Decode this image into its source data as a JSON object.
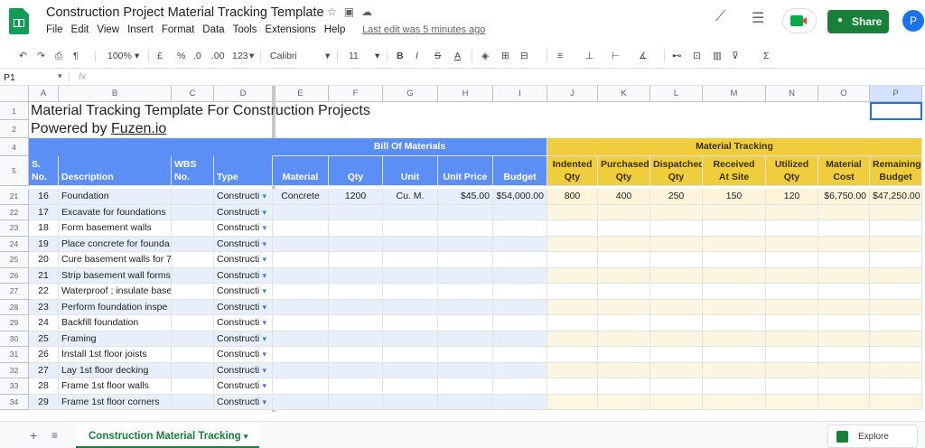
{
  "header": {
    "title": "Construction Project Material Tracking Template",
    "menus": [
      "File",
      "Edit",
      "View",
      "Insert",
      "Format",
      "Data",
      "Tools",
      "Extensions",
      "Help"
    ],
    "last_edit": "Last edit was 5 minutes ago",
    "share_label": "Share",
    "avatar_initial": "P"
  },
  "toolbar": {
    "zoom": "100%",
    "currency": "£",
    "percent": "%",
    "dec_dec": ".0",
    "dec_inc": ".00",
    "more_formats": "123",
    "font": "Calibri",
    "font_size": "11"
  },
  "formula_bar": {
    "cell_ref": "P1",
    "fx": "fx",
    "value": ""
  },
  "columns": [
    "A",
    "B",
    "C",
    "D",
    "E",
    "F",
    "G",
    "H",
    "I",
    "J",
    "K",
    "L",
    "M",
    "N",
    "O",
    "P"
  ],
  "sheet": {
    "title": "Material Tracking Template For Construction Projects",
    "powered_prefix": "Powered by ",
    "powered_link": "Fuzen.io",
    "bom_header": "Bill Of Materials",
    "mt_header": "Material Tracking",
    "headers": {
      "sno": "S. No.",
      "desc": "Description",
      "wbs1": "WBS",
      "wbs2": "No.",
      "type": "Type",
      "material": "Material",
      "qty": "Qty",
      "unit": "Unit",
      "unit_price": "Unit Price",
      "budget": "Budget",
      "indented1": "Indented",
      "indented2": "Qty",
      "purchased1": "Purchased",
      "purchased2": "Qty",
      "dispatched1": "Dispatched",
      "dispatched2": "Qty",
      "received1": "Qty Received",
      "received2": "At Site",
      "utilized1": "Utilized",
      "utilized2": "Qty",
      "matcost1": "Material",
      "matcost2": "Cost",
      "remain1": "Remaining",
      "remain2": "Budget"
    },
    "header_row_numbers": [
      "1",
      "2",
      "4",
      "5"
    ],
    "rows": [
      {
        "row": "21",
        "sno": "16",
        "desc": "Foundation",
        "type": "Constructi",
        "material": "Concrete",
        "qty": "1200",
        "unit": "Cu. M.",
        "unit_price": "$45.00",
        "budget": "$54,000.00",
        "indented": "800",
        "purchased": "400",
        "dispatched": "250",
        "received": "150",
        "utilized": "120",
        "matcost": "$6,750.00",
        "remain": "$47,250.00"
      },
      {
        "row": "22",
        "sno": "17",
        "desc": "Excavate for foundations",
        "type": "Constructi"
      },
      {
        "row": "23",
        "sno": "18",
        "desc": "Form basement walls",
        "type": "Constructi"
      },
      {
        "row": "24",
        "sno": "19",
        "desc": "Place concrete for founda",
        "type": "Constructi"
      },
      {
        "row": "25",
        "sno": "20",
        "desc": "Cure basement walls for 7",
        "type": "Constructi"
      },
      {
        "row": "26",
        "sno": "21",
        "desc": "Strip basement wall forms",
        "type": "Constructi"
      },
      {
        "row": "27",
        "sno": "22",
        "desc": "Waterproof ; insulate base",
        "type": "Constructi"
      },
      {
        "row": "28",
        "sno": "23",
        "desc": "Perform foundation inspe",
        "type": "Constructi"
      },
      {
        "row": "29",
        "sno": "24",
        "desc": "Backfill foundation",
        "type": "Constructi"
      },
      {
        "row": "30",
        "sno": "25",
        "desc": "Framing",
        "type": "Constructi"
      },
      {
        "row": "31",
        "sno": "26",
        "desc": "Install 1st floor joists",
        "type": "Constructi"
      },
      {
        "row": "32",
        "sno": "27",
        "desc": "Lay 1st floor decking",
        "type": "Constructi"
      },
      {
        "row": "33",
        "sno": "28",
        "desc": "Frame 1st floor walls",
        "type": "Constructi"
      },
      {
        "row": "34",
        "sno": "29",
        "desc": "Frame 1st floor corners",
        "type": "Constructi"
      }
    ],
    "tab_name": "Construction Material Tracking",
    "explore_label": "Explore"
  },
  "colors": {
    "bom_blue": "#5b8ff5",
    "tracking_yellow": "#f0cd3d",
    "green": "#188038"
  }
}
